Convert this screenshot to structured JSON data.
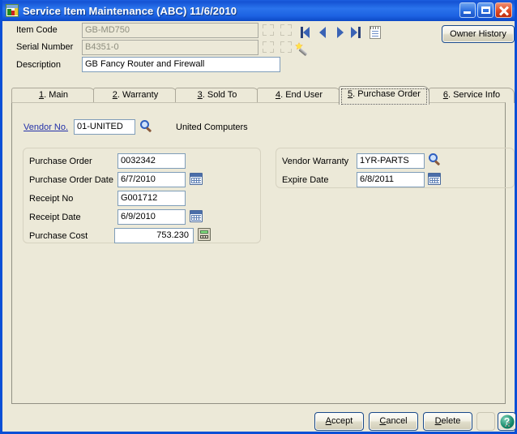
{
  "window": {
    "title": "Service Item Maintenance (ABC) 11/6/2010",
    "icon": "app-icon",
    "minimize_label": "",
    "maximize_label": "",
    "close_label": ""
  },
  "header": {
    "item_code_label": "Item Code",
    "item_code_value": "GB-MD750",
    "serial_number_label": "Serial Number",
    "serial_number_value": "B4351-0",
    "description_label": "Description",
    "description_value": "GB Fancy Router and Firewall",
    "owner_history_button": "Owner History",
    "nav": {
      "first": "first-record",
      "prev": "previous-record",
      "next": "next-record",
      "last": "last-record",
      "memo": "memo"
    }
  },
  "tabs": [
    {
      "num": "1",
      "label": ". Main",
      "active": false
    },
    {
      "num": "2",
      "label": ". Warranty",
      "active": false
    },
    {
      "num": "3",
      "label": ". Sold To",
      "active": false
    },
    {
      "num": "4",
      "label": ". End User",
      "active": false
    },
    {
      "num": "5",
      "label": ". Purchase Order",
      "active": true
    },
    {
      "num": "6",
      "label": ". Service Info",
      "active": false
    }
  ],
  "purchase_order_tab": {
    "vendor_no_label": "Vendor No.",
    "vendor_no_value": "01-UNITED",
    "vendor_name": "United Computers",
    "left_panel": {
      "rows": [
        {
          "label": "Purchase Order",
          "value": "0032342",
          "icon": "none",
          "align": "left"
        },
        {
          "label": "Purchase Order Date",
          "value": "6/7/2010",
          "icon": "calendar-icon",
          "align": "left"
        },
        {
          "label": "Receipt No",
          "value": "G001712",
          "icon": "none",
          "align": "left"
        },
        {
          "label": "Receipt Date",
          "value": "6/9/2010",
          "icon": "calendar-icon",
          "align": "left"
        },
        {
          "label": "Purchase Cost",
          "value": "753.230",
          "icon": "calculator-icon",
          "align": "right"
        }
      ]
    },
    "right_panel": {
      "rows": [
        {
          "label": "Vendor Warranty",
          "value": "1YR-PARTS",
          "icon": "lookup-icon"
        },
        {
          "label": "Expire Date",
          "value": "6/8/2011",
          "icon": "calendar-icon"
        }
      ]
    }
  },
  "footer": {
    "accept": "Accept",
    "cancel": "Cancel",
    "delete": "Delete",
    "help": "?"
  },
  "colors": {
    "title_bar": "#1d62e2",
    "window_border": "#0a4fd6",
    "form_background": "#ece9d8",
    "field_border": "#7f9db9",
    "link": "#2331a8",
    "readonly_text": "#8d8d7e"
  }
}
